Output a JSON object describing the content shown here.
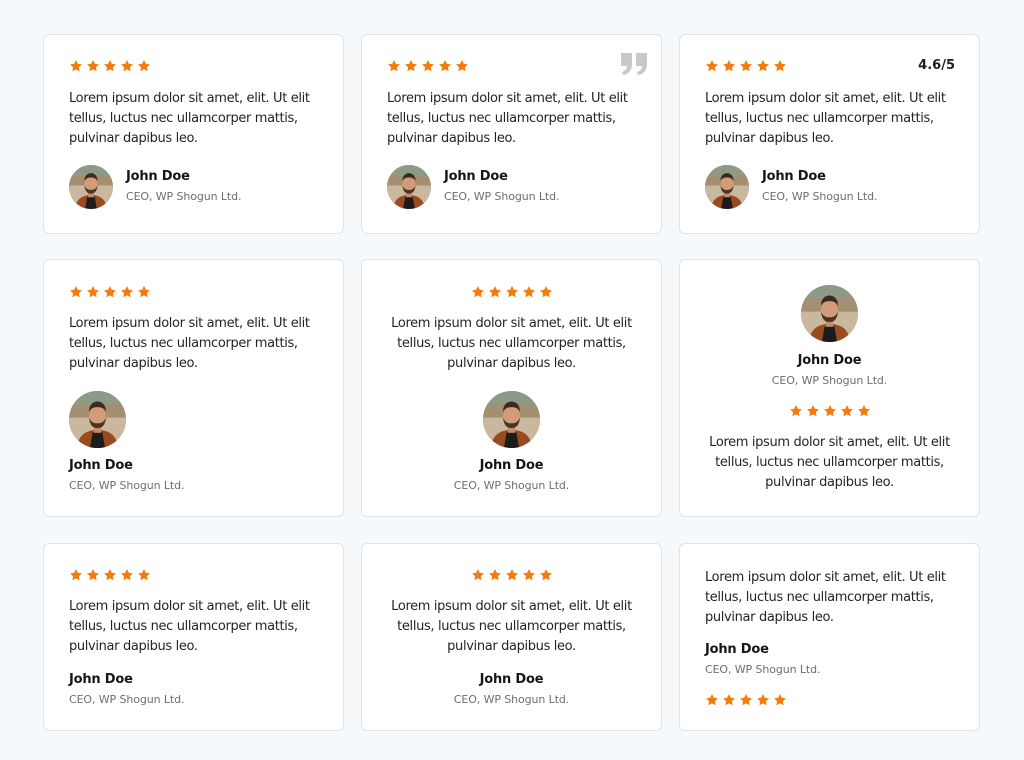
{
  "colors": {
    "accent": "#f47b0d",
    "card_border": "#dfe3ea",
    "background": "#f6f9fc"
  },
  "icons": {
    "star": "star-icon",
    "quote": "quote-icon"
  },
  "testimonial": {
    "name": "John Doe",
    "role": "CEO, WP Shogun Ltd.",
    "text_lines": [
      "Lorem ipsum dolor sit amet, elit. Ut elit",
      "tellus, luctus nec ullamcorper mattis,",
      "pulvinar dapibus leo."
    ],
    "stars": 5
  },
  "cards": [
    {
      "layout": "stars-text-avatar-side"
    },
    {
      "layout": "stars-text-avatar-side-quote"
    },
    {
      "layout": "stars-text-avatar-side-rating",
      "rating": "4.6/5"
    },
    {
      "layout": "stars-text-avatar-stacked"
    },
    {
      "layout": "centered-stars-text-avatar"
    },
    {
      "layout": "centered-avatar-stars-text"
    },
    {
      "layout": "stars-text-name"
    },
    {
      "layout": "centered-stars-text-name"
    },
    {
      "layout": "text-name-stars"
    }
  ]
}
